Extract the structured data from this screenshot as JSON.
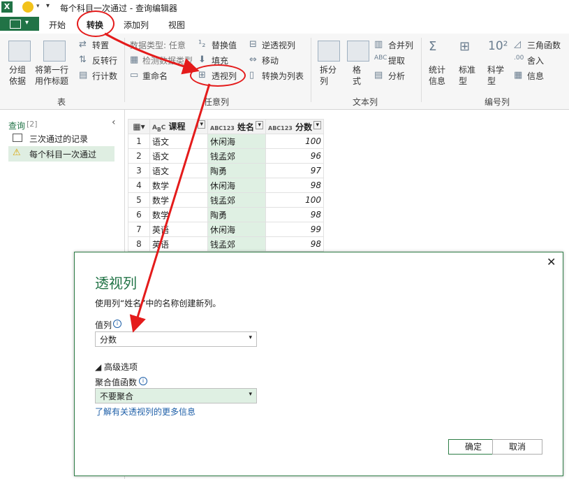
{
  "window": {
    "title": "每个科目一次通过 - 查询编辑器"
  },
  "ribbon_tabs": [
    "开始",
    "转换",
    "添加列",
    "视图"
  ],
  "ribbon": {
    "table_group": {
      "label": "表",
      "group_by": "分组\n依据",
      "use_first_row": "将第一行\n用作标题",
      "transpose": "转置",
      "reverse_rows": "反转行",
      "count_rows": "行计数"
    },
    "any_column_group": {
      "label": "任意列",
      "data_type": "数据类型: 任意",
      "detect_type": "检测数据类型",
      "rename": "重命名",
      "replace_values": "替换值",
      "fill": "填充",
      "pivot_column": "透视列",
      "unpivot_columns": "逆透视列",
      "move": "移动",
      "convert_to_list": "转换为列表"
    },
    "text_column_group": {
      "label": "文本列",
      "split_column": "拆分\n列",
      "format": "格\n式",
      "merge_columns": "合并列",
      "extract": "提取",
      "parse": "分析"
    },
    "number_column_group": {
      "label": "编号列",
      "statistics": "统计\n信息",
      "standard": "标准\n型",
      "scientific": "科学\n型",
      "trigonometry": "三角函数",
      "rounding": "舍入",
      "information": "信息"
    }
  },
  "queries_pane": {
    "header": "查询",
    "count": "[2]",
    "items": [
      "三次通过的记录",
      "每个科目一次通过"
    ]
  },
  "table": {
    "columns": [
      "课程",
      "姓名",
      "分数"
    ],
    "rows": [
      {
        "n": "1",
        "course": "语文",
        "name": "休闲海",
        "score": "100"
      },
      {
        "n": "2",
        "course": "语文",
        "name": "钱孟郊",
        "score": "96"
      },
      {
        "n": "3",
        "course": "语文",
        "name": "陶勇",
        "score": "97"
      },
      {
        "n": "4",
        "course": "数学",
        "name": "休闲海",
        "score": "98"
      },
      {
        "n": "5",
        "course": "数学",
        "name": "钱孟郊",
        "score": "100"
      },
      {
        "n": "6",
        "course": "数学",
        "name": "陶勇",
        "score": "98"
      },
      {
        "n": "7",
        "course": "英语",
        "name": "休闲海",
        "score": "99"
      },
      {
        "n": "8",
        "course": "英语",
        "name": "钱孟郊",
        "score": "98"
      }
    ]
  },
  "dialog": {
    "title": "透视列",
    "description": "使用列“姓名”中的名称创建新列。",
    "values_column_label": "值列",
    "values_column_value": "分数",
    "advanced_label": "◢ 高级选项",
    "aggregate_label": "聚合值函数",
    "aggregate_value": "不要聚合",
    "learn_more": "了解有关透视列的更多信息",
    "ok": "确定",
    "cancel": "取消"
  },
  "colors": {
    "accent": "#217346",
    "highlight_green": "#dff0e3",
    "annotation_red": "#e41b1b",
    "link_blue": "#1e5fa8"
  }
}
